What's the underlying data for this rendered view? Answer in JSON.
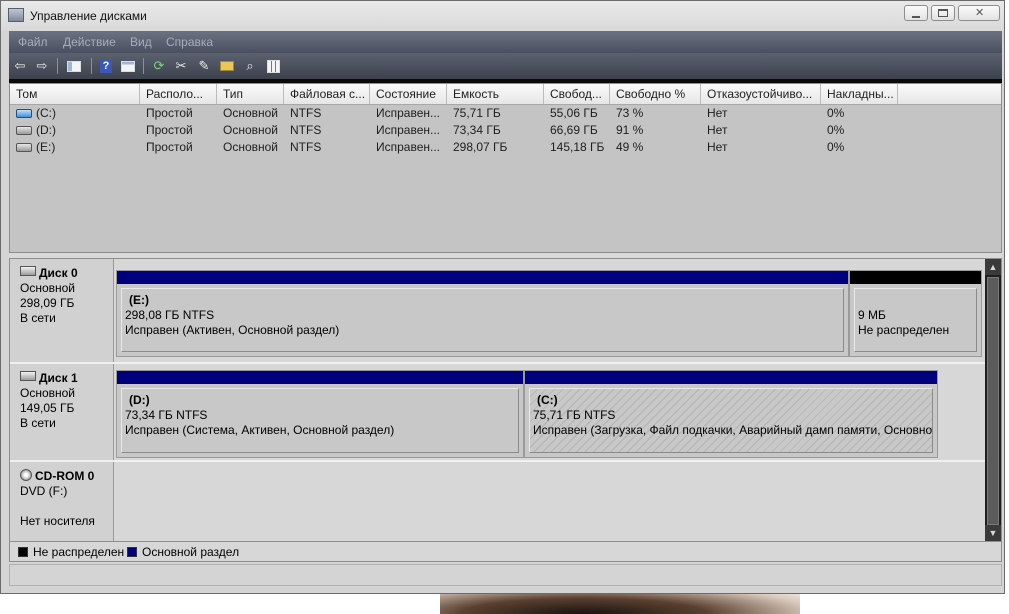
{
  "window": {
    "title": "Управление дисками"
  },
  "menu": [
    {
      "label": "Файл"
    },
    {
      "label": "Действие"
    },
    {
      "label": "Вид"
    },
    {
      "label": "Справка"
    }
  ],
  "toolbar": {
    "icons": [
      "back-icon",
      "forward-icon",
      "console-tree-icon",
      "help-icon",
      "properties-icon",
      "refresh-icon",
      "delete-icon",
      "edit-icon",
      "folder-icon",
      "search-icon",
      "settings-icon"
    ]
  },
  "volume_list": {
    "columns": [
      "Том",
      "Располо...",
      "Тип",
      "Файловая с...",
      "Состояние",
      "Емкость",
      "Свобод...",
      "Свободно %",
      "Отказоустойчиво...",
      "Накладны..."
    ],
    "rows": [
      {
        "cells": [
          "(C:)",
          "Простой",
          "Основной",
          "NTFS",
          "Исправен...",
          "75,71 ГБ",
          "55,06 ГБ",
          "73 %",
          "Нет",
          "0%"
        ]
      },
      {
        "cells": [
          "(D:)",
          "Простой",
          "Основной",
          "NTFS",
          "Исправен...",
          "73,34 ГБ",
          "66,69 ГБ",
          "91 %",
          "Нет",
          "0%"
        ]
      },
      {
        "cells": [
          "(E:)",
          "Простой",
          "Основной",
          "NTFS",
          "Исправен...",
          "298,07 ГБ",
          "145,18 ГБ",
          "49 %",
          "Нет",
          "0%"
        ]
      }
    ]
  },
  "disks": [
    {
      "name": "Диск 0",
      "type": "Основной",
      "size": "298,09 ГБ",
      "status": "В сети",
      "partitions": [
        {
          "name": "(E:)",
          "size": "298,08 ГБ NTFS",
          "status": "Исправен (Активен, Основной раздел)"
        },
        {
          "name": "",
          "size": "9 МБ",
          "status": "Не распределен"
        }
      ]
    },
    {
      "name": "Диск 1",
      "type": "Основной",
      "size": "149,05 ГБ",
      "status": "В сети",
      "partitions": [
        {
          "name": "(D:)",
          "size": "73,34 ГБ NTFS",
          "status": "Исправен (Система, Активен, Основной раздел)"
        },
        {
          "name": "(C:)",
          "size": "75,71 ГБ NTFS",
          "status": "Исправен (Загрузка, Файл подкачки, Аварийный дамп памяти, Основной раздел)"
        }
      ]
    },
    {
      "name": "CD-ROM 0",
      "type": "DVD (F:)",
      "status": "Нет носителя"
    }
  ],
  "legend": [
    {
      "label": "Не распределен",
      "color": "#000000"
    },
    {
      "label": "Основной раздел",
      "color": "#00007f"
    }
  ]
}
